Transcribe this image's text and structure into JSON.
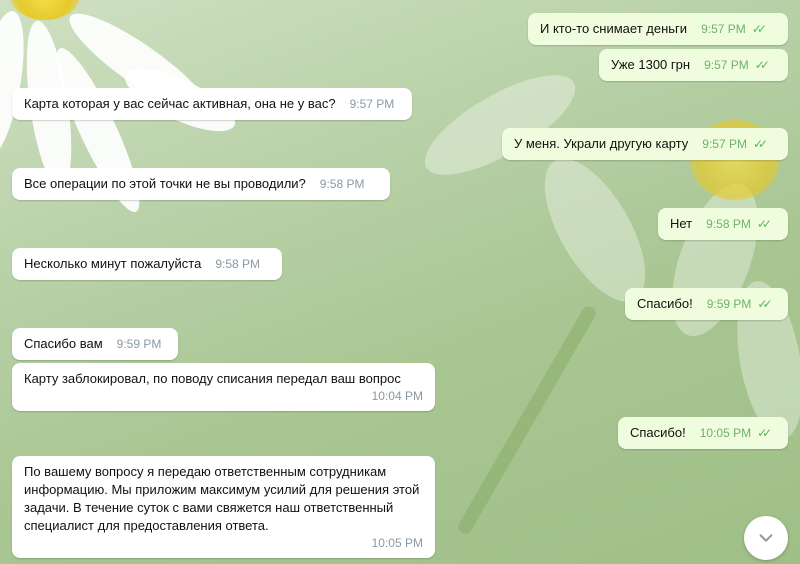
{
  "messages": [
    {
      "dir": "out",
      "text": "И кто-то снимает деньги",
      "time": "9:57 PM"
    },
    {
      "dir": "out",
      "text": "Уже 1300 грн",
      "time": "9:57 PM"
    },
    {
      "dir": "in",
      "text": "Карта которая у вас сейчас активная, она не у вас?",
      "time": "9:57 PM"
    },
    {
      "dir": "out",
      "text": "У меня. Украли другую карту",
      "time": "9:57 PM"
    },
    {
      "dir": "in",
      "text": "Все операции по этой точки не вы проводили?",
      "time": "9:58 PM"
    },
    {
      "dir": "out",
      "text": "Нет",
      "time": "9:58 PM"
    },
    {
      "dir": "in",
      "text": "Несколько минут пожалуйста",
      "time": "9:58 PM"
    },
    {
      "dir": "out",
      "text": "Спасибо!",
      "time": "9:59 PM"
    },
    {
      "dir": "in",
      "text": "Спасибо вам",
      "time": "9:59 PM"
    },
    {
      "dir": "in",
      "text": "Карту заблокировал, по поводу списания передал ваш вопрос",
      "time": "10:04 PM"
    },
    {
      "dir": "out",
      "text": "Спасибо!",
      "time": "10:05 PM"
    },
    {
      "dir": "in",
      "text": "По вашему вопросу я передаю ответственным сотрудникам информацию. Мы приложим максимум усилий для решения этой задачи. В течение суток с вами свяжется наш ответственный специалист для предоставления ответа.",
      "time": "10:05 PM"
    }
  ],
  "icons": {
    "read_receipt": "double-check-icon",
    "scroll_down": "chevron-down-icon"
  },
  "colors": {
    "incoming_bubble": "#ffffff",
    "outgoing_bubble": "#effdde",
    "check": "#5db55b"
  }
}
